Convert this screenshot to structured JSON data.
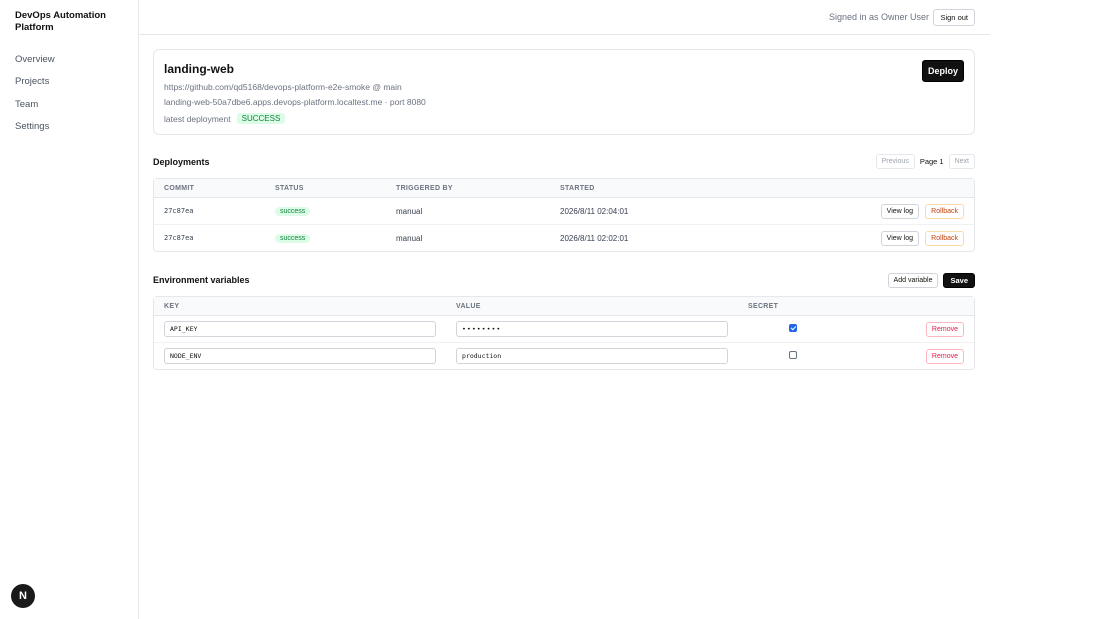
{
  "app": {
    "title": "DevOps Automation Platform"
  },
  "nav": [
    {
      "label": "Overview"
    },
    {
      "label": "Projects"
    },
    {
      "label": "Team"
    },
    {
      "label": "Settings"
    }
  ],
  "header": {
    "signed_in_text": "Signed in as Owner User",
    "sign_out_label": "Sign out"
  },
  "project": {
    "name": "landing-web",
    "repo": "https://github.com/qd5168/devops-platform-e2e-smoke @ main",
    "host": "landing-web-50a7dbe6.apps.devops-platform.localtest.me · port 8080",
    "latest_label": "latest deployment",
    "latest_status": "SUCCESS",
    "deploy_label": "Deploy"
  },
  "deployments": {
    "title": "Deployments",
    "pager": {
      "previous": "Previous",
      "page": "Page 1",
      "next": "Next"
    },
    "columns": {
      "commit": "COMMIT",
      "status": "STATUS",
      "triggered_by": "TRIGGERED BY",
      "started": "STARTED"
    },
    "rows": [
      {
        "commit": "27c87ea",
        "status": "success",
        "triggered_by": "manual",
        "started": "2026/8/11 02:04:01",
        "view_log": "View log",
        "rollback": "Rollback"
      },
      {
        "commit": "27c87ea",
        "status": "success",
        "triggered_by": "manual",
        "started": "2026/8/11 02:02:01",
        "view_log": "View log",
        "rollback": "Rollback"
      }
    ]
  },
  "env": {
    "title": "Environment variables",
    "add_label": "Add variable",
    "save_label": "Save",
    "columns": {
      "key": "KEY",
      "value": "VALUE",
      "secret": "SECRET"
    },
    "rows": [
      {
        "key": "API_KEY",
        "value": "••••••••",
        "secret": true,
        "remove": "Remove"
      },
      {
        "key": "NODE_ENV",
        "value": "production",
        "secret": false,
        "remove": "Remove"
      }
    ]
  },
  "footer": {
    "badge_letter": "N"
  },
  "colors": {
    "accent": "#111111",
    "success_bg": "#dcfce7",
    "success_text": "#15803d",
    "rollback": "#c2410c",
    "remove": "#e11d48",
    "checkbox": "#2563eb"
  }
}
